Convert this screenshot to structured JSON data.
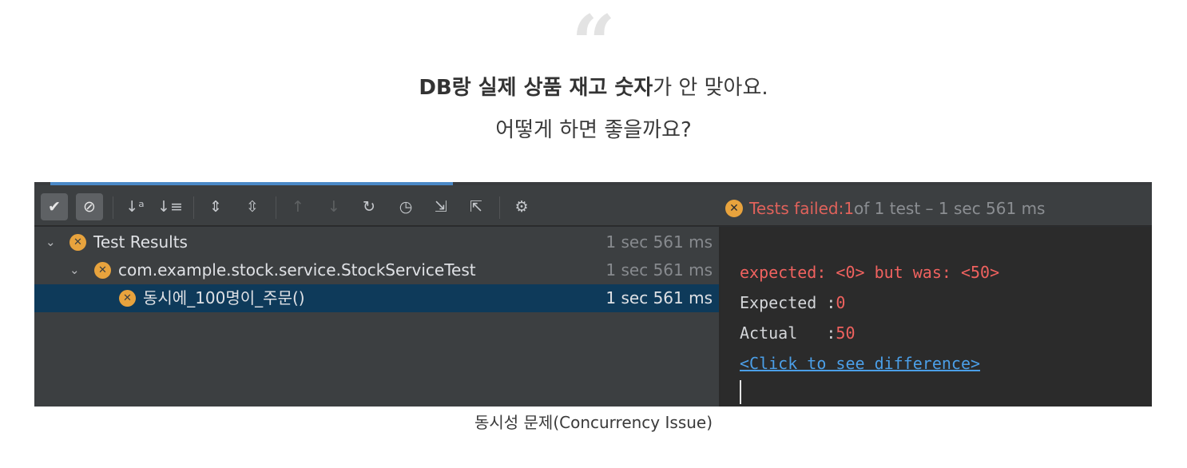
{
  "quote_mark": "“",
  "headline": {
    "bold": "DB랑 실제 상품 재고 숫자",
    "normal": "가 안 맞아요."
  },
  "subline": "어떻게 하면 좋을까요?",
  "ide": {
    "progress": 0.36,
    "toolbar": {
      "buttons": [
        {
          "name": "show-passed-icon",
          "glyph": "✔",
          "toggled": true,
          "disabled": false
        },
        {
          "name": "show-ignored-icon",
          "glyph": "⊘",
          "toggled": true,
          "disabled": false
        },
        {
          "name": "sort-alphabetically-icon",
          "glyph": "↓ᵃ",
          "toggled": false,
          "disabled": false
        },
        {
          "name": "sort-by-duration-icon",
          "glyph": "↓≡",
          "toggled": false,
          "disabled": false
        },
        {
          "name": "expand-all-icon",
          "glyph": "⇕",
          "toggled": false,
          "disabled": false
        },
        {
          "name": "collapse-all-icon",
          "glyph": "⇳",
          "toggled": false,
          "disabled": false
        },
        {
          "name": "previous-failed-icon",
          "glyph": "↑",
          "toggled": false,
          "disabled": true
        },
        {
          "name": "next-failed-icon",
          "glyph": "↓",
          "toggled": false,
          "disabled": true
        },
        {
          "name": "rerun-failed-icon",
          "glyph": "🐢",
          "toggled": false,
          "disabled": false
        },
        {
          "name": "test-history-icon",
          "glyph": "◷",
          "toggled": false,
          "disabled": false
        },
        {
          "name": "import-tests-icon",
          "glyph": "⇲",
          "toggled": false,
          "disabled": false
        },
        {
          "name": "export-tests-icon",
          "glyph": "⇱",
          "toggled": false,
          "disabled": false
        },
        {
          "name": "settings-gear-icon",
          "glyph": "⚙",
          "toggled": false,
          "disabled": false
        }
      ],
      "status": {
        "label": "Tests failed: ",
        "failed_count": "1",
        "rest": " of 1 test – 1 sec 561 ms"
      }
    },
    "tree": [
      {
        "label": "Test Results",
        "duration": "1 sec 561 ms",
        "expanded": true,
        "level": 0,
        "selected": false
      },
      {
        "label": "com.example.stock.service.StockServiceTest",
        "duration": "1 sec 561 ms",
        "expanded": true,
        "level": 1,
        "selected": false
      },
      {
        "label": "동시에_100명이_주문()",
        "duration": "1 sec 561 ms",
        "expanded": false,
        "level": 2,
        "selected": true
      }
    ],
    "console": {
      "error": "expected: <0> but was: <50>",
      "expected_label": "Expected :",
      "expected_value": "0",
      "actual_label": "Actual   :",
      "actual_value": "50",
      "diff_link": "<Click to see difference>"
    },
    "colors": {
      "fail_icon": "#e8a33d",
      "error_red": "#f0625f",
      "link_blue": "#4b9fe8",
      "selection": "#0e3a5a"
    }
  },
  "caption": "동시성 문제(Concurrency Issue)"
}
